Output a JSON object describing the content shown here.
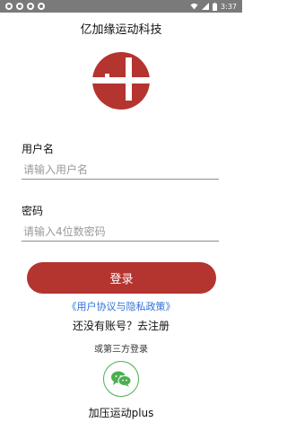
{
  "status_bar": {
    "time": "3:37",
    "left_icons": [
      "notification-icon",
      "notification-icon",
      "notification-icon",
      "notification-icon"
    ],
    "right_icons": [
      "wifi-icon",
      "signal-icon",
      "battery-icon"
    ]
  },
  "header": {
    "title": "亿加缘运动科技"
  },
  "logo": {
    "icon": "brand-logo",
    "color": "#b4342f"
  },
  "form": {
    "username": {
      "label": "用户名",
      "placeholder": "请输入用户名",
      "value": ""
    },
    "password": {
      "label": "密码",
      "placeholder": "请输入4位数密码",
      "value": ""
    }
  },
  "actions": {
    "login_label": "登录",
    "policy_link": "《用户协议与隐私政策》",
    "register_text": "还没有账号？去注册"
  },
  "third_party": {
    "label": "或第三方登录",
    "wechat_icon": "wechat-icon"
  },
  "footer": {
    "app_name": "加压运动plus"
  },
  "colors": {
    "accent": "#b4342f",
    "link": "#2f6fd6",
    "wechat": "#4caf50",
    "status_bar": "#7a7a7a"
  }
}
